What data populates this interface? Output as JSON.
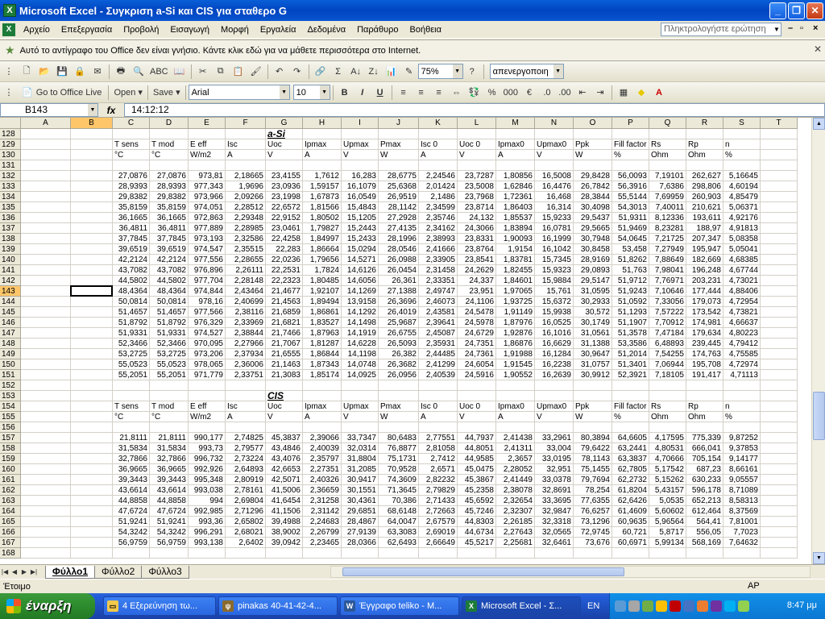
{
  "window": {
    "title": "Microsoft Excel - Συγκριση a-Si και CIS για σταθερο G"
  },
  "menu": {
    "items": [
      "Αρχείο",
      "Επεξεργασία",
      "Προβολή",
      "Εισαγωγή",
      "Μορφή",
      "Εργαλεία",
      "Δεδομένα",
      "Παράθυρο",
      "Βοήθεια"
    ],
    "ask_placeholder": "Πληκτρολογήστε ερώτηση"
  },
  "infobar": {
    "text": "Αυτό το αντίγραφο του Office δεν είναι γνήσιο. Κάντε κλικ εδώ για να μάθετε περισσότερα στο Internet."
  },
  "toolbar1": {
    "zoom": "75%",
    "style_combo": "απενεργοποιη"
  },
  "toolbar2": {
    "office_live": "Go to Office Live",
    "open": "Open",
    "save": "Save",
    "font": "Arial",
    "size": "10"
  },
  "formula": {
    "namebox": "B143",
    "fx": "fx",
    "content": "14:12:12"
  },
  "columns": [
    "A",
    "B",
    "C",
    "D",
    "E",
    "F",
    "G",
    "H",
    "I",
    "J",
    "K",
    "L",
    "M",
    "N",
    "O",
    "P",
    "Q",
    "R",
    "S",
    "T"
  ],
  "selected_col": "B",
  "selected_row": "143",
  "sections": {
    "asi_title": "a-Si",
    "cis_title": "CIS"
  },
  "headers": [
    "T sens",
    "T mod",
    "E eff",
    "Isc",
    "Uoc",
    "Ipmax",
    "Upmax",
    "Pmax",
    "Isc 0",
    "Uoc 0",
    "Ipmax0",
    "Upmax0",
    "Ppk",
    "Fill factor",
    "Rs",
    "Rp",
    "n"
  ],
  "units": [
    "°C",
    "°C",
    "W/m2",
    "A",
    "V",
    "A",
    "V",
    "W",
    "A",
    "V",
    "A",
    "V",
    "W",
    "%",
    "Ohm",
    "Ohm",
    "%"
  ],
  "rows": [
    {
      "n": "128",
      "type": "title",
      "title": "a-Si"
    },
    {
      "n": "129",
      "type": "header"
    },
    {
      "n": "130",
      "type": "units"
    },
    {
      "n": "131",
      "type": "empty"
    },
    {
      "n": "132",
      "type": "data",
      "v": [
        "27,0876",
        "27,0876",
        "973,81",
        "2,18665",
        "23,4155",
        "1,7612",
        "16,283",
        "28,6775",
        "2,24546",
        "23,7287",
        "1,80856",
        "16,5008",
        "29,8428",
        "56,0093",
        "7,19101",
        "262,627",
        "5,16645"
      ]
    },
    {
      "n": "133",
      "type": "data",
      "v": [
        "28,9393",
        "28,9393",
        "977,343",
        "1,9696",
        "23,0936",
        "1,59157",
        "16,1079",
        "25,6368",
        "2,01424",
        "23,5008",
        "1,62846",
        "16,4476",
        "26,7842",
        "56,3916",
        "7,6386",
        "298,806",
        "4,60194"
      ]
    },
    {
      "n": "134",
      "type": "data",
      "v": [
        "29,8382",
        "29,8382",
        "973,966",
        "2,09266",
        "23,1998",
        "1,67873",
        "16,0549",
        "26,9519",
        "2,1486",
        "23,7968",
        "1,72361",
        "16,468",
        "28,3844",
        "55,5144",
        "7,69959",
        "260,903",
        "4,85479"
      ]
    },
    {
      "n": "135",
      "type": "data",
      "v": [
        "35,8159",
        "35,8159",
        "974,051",
        "2,28512",
        "22,6572",
        "1,81566",
        "15,4843",
        "28,1142",
        "2,34599",
        "23,8714",
        "1,86403",
        "16,314",
        "30,4098",
        "54,3013",
        "7,40011",
        "210,621",
        "5,06371"
      ]
    },
    {
      "n": "136",
      "type": "data",
      "v": [
        "36,1665",
        "36,1665",
        "972,863",
        "2,29348",
        "22,9152",
        "1,80502",
        "15,1205",
        "27,2928",
        "2,35746",
        "24,132",
        "1,85537",
        "15,9233",
        "29,5437",
        "51,9311",
        "8,12336",
        "193,611",
        "4,92176"
      ]
    },
    {
      "n": "137",
      "type": "data",
      "v": [
        "36,4811",
        "36,4811",
        "977,889",
        "2,28985",
        "23,0461",
        "1,79827",
        "15,2443",
        "27,4135",
        "2,34162",
        "24,3066",
        "1,83894",
        "16,0781",
        "29,5665",
        "51,9469",
        "8,23281",
        "188,97",
        "4,91813"
      ]
    },
    {
      "n": "138",
      "type": "data",
      "v": [
        "37,7845",
        "37,7845",
        "973,193",
        "2,32586",
        "22,4258",
        "1,84997",
        "15,2433",
        "28,1996",
        "2,38993",
        "23,8331",
        "1,90093",
        "16,1999",
        "30,7948",
        "54,0645",
        "7,21725",
        "207,347",
        "5,08358"
      ]
    },
    {
      "n": "139",
      "type": "data",
      "v": [
        "39,6519",
        "39,6519",
        "974,547",
        "2,35515",
        "22,283",
        "1,86664",
        "15,0294",
        "28,0546",
        "2,41666",
        "23,8764",
        "1,9154",
        "16,1042",
        "30,8458",
        "53,458",
        "7,27949",
        "195,947",
        "5,05041"
      ]
    },
    {
      "n": "140",
      "type": "data",
      "v": [
        "42,2124",
        "42,2124",
        "977,556",
        "2,28655",
        "22,0236",
        "1,79656",
        "14,5271",
        "26,0988",
        "2,33905",
        "23,8541",
        "1,83781",
        "15,7345",
        "28,9169",
        "51,8262",
        "7,88649",
        "182,669",
        "4,68385"
      ]
    },
    {
      "n": "141",
      "type": "data",
      "v": [
        "43,7082",
        "43,7082",
        "976,896",
        "2,26111",
        "22,2531",
        "1,7824",
        "14,6126",
        "26,0454",
        "2,31458",
        "24,2629",
        "1,82455",
        "15,9323",
        "29,0893",
        "51,763",
        "7,98041",
        "196,248",
        "4,67744"
      ]
    },
    {
      "n": "142",
      "type": "data",
      "v": [
        "44,5802",
        "44,5802",
        "977,704",
        "2,28148",
        "22,2323",
        "1,80485",
        "14,6056",
        "26,361",
        "2,33351",
        "24,337",
        "1,84601",
        "15,9884",
        "29,5147",
        "51,9712",
        "7,76971",
        "203,231",
        "4,73021"
      ]
    },
    {
      "n": "143",
      "type": "data",
      "v": [
        "48,4364",
        "48,4364",
        "974,844",
        "2,43464",
        "21,4677",
        "1,92107",
        "14,1269",
        "27,1388",
        "2,49747",
        "23,951",
        "1,97065",
        "15,761",
        "31,0595",
        "51,9243",
        "7,10646",
        "177,444",
        "4,88406"
      ]
    },
    {
      "n": "144",
      "type": "data",
      "v": [
        "50,0814",
        "50,0814",
        "978,16",
        "2,40699",
        "21,4563",
        "1,89494",
        "13,9158",
        "26,3696",
        "2,46073",
        "24,1106",
        "1,93725",
        "15,6372",
        "30,2933",
        "51,0592",
        "7,33056",
        "179,073",
        "4,72954"
      ]
    },
    {
      "n": "145",
      "type": "data",
      "v": [
        "51,4657",
        "51,4657",
        "977,566",
        "2,38116",
        "21,6859",
        "1,86861",
        "14,1292",
        "26,4019",
        "2,43581",
        "24,5478",
        "1,91149",
        "15,9938",
        "30,572",
        "51,1293",
        "7,57222",
        "173,542",
        "4,73821"
      ]
    },
    {
      "n": "146",
      "type": "data",
      "v": [
        "51,8792",
        "51,8792",
        "976,329",
        "2,33969",
        "21,6821",
        "1,83527",
        "14,1498",
        "25,9687",
        "2,39641",
        "24,5978",
        "1,87976",
        "16,0525",
        "30,1749",
        "51,1907",
        "7,70912",
        "174,981",
        "4,66637"
      ]
    },
    {
      "n": "147",
      "type": "data",
      "v": [
        "51,9331",
        "51,9331",
        "974,527",
        "2,38844",
        "21,7466",
        "1,87963",
        "14,1919",
        "26,6755",
        "2,45087",
        "24,6729",
        "1,92876",
        "16,1016",
        "31,0561",
        "51,3578",
        "7,47184",
        "179,634",
        "4,80223"
      ]
    },
    {
      "n": "148",
      "type": "data",
      "v": [
        "52,3466",
        "52,3466",
        "970,095",
        "2,27966",
        "21,7067",
        "1,81287",
        "14,6228",
        "26,5093",
        "2,35931",
        "24,7351",
        "1,86876",
        "16,6629",
        "31,1388",
        "53,3586",
        "6,48893",
        "239,445",
        "4,79412"
      ]
    },
    {
      "n": "149",
      "type": "data",
      "v": [
        "53,2725",
        "53,2725",
        "973,206",
        "2,37934",
        "21,6555",
        "1,86844",
        "14,1198",
        "26,382",
        "2,44485",
        "24,7361",
        "1,91988",
        "16,1284",
        "30,9647",
        "51,2014",
        "7,54255",
        "174,763",
        "4,75585"
      ]
    },
    {
      "n": "150",
      "type": "data",
      "v": [
        "55,0523",
        "55,0523",
        "978,065",
        "2,36006",
        "21,1463",
        "1,87343",
        "14,0748",
        "26,3682",
        "2,41299",
        "24,6054",
        "1,91545",
        "16,2238",
        "31,0757",
        "51,3401",
        "7,06944",
        "195,708",
        "4,72974"
      ]
    },
    {
      "n": "151",
      "type": "data",
      "v": [
        "55,2051",
        "55,2051",
        "971,779",
        "2,33751",
        "21,3083",
        "1,85174",
        "14,0925",
        "26,0956",
        "2,40539",
        "24,5916",
        "1,90552",
        "16,2639",
        "30,9912",
        "52,3921",
        "7,18105",
        "191,417",
        "4,71113"
      ]
    },
    {
      "n": "152",
      "type": "empty"
    },
    {
      "n": "153",
      "type": "title",
      "title": "CIS"
    },
    {
      "n": "154",
      "type": "header"
    },
    {
      "n": "155",
      "type": "units"
    },
    {
      "n": "156",
      "type": "empty"
    },
    {
      "n": "157",
      "type": "data",
      "v": [
        "21,8111",
        "21,8111",
        "990,177",
        "2,74825",
        "45,3837",
        "2,39066",
        "33,7347",
        "80,6483",
        "2,77551",
        "44,7937",
        "2,41438",
        "33,2961",
        "80,3894",
        "64,6605",
        "4,17595",
        "775,339",
        "9,87252"
      ]
    },
    {
      "n": "158",
      "type": "data",
      "v": [
        "31,5834",
        "31,5834",
        "993,73",
        "2,79577",
        "43,4846",
        "2,40039",
        "32,0314",
        "76,8877",
        "2,81058",
        "44,8051",
        "2,41311",
        "33,004",
        "79,6422",
        "63,2441",
        "4,80531",
        "666,041",
        "9,37853"
      ]
    },
    {
      "n": "159",
      "type": "data",
      "v": [
        "32,7866",
        "32,7866",
        "996,732",
        "2,73224",
        "43,4076",
        "2,35797",
        "31,8804",
        "75,1731",
        "2,7412",
        "44,9585",
        "2,3657",
        "33,0195",
        "78,1143",
        "63,3837",
        "4,70666",
        "705,154",
        "9,14177"
      ]
    },
    {
      "n": "160",
      "type": "data",
      "v": [
        "36,9665",
        "36,9665",
        "992,926",
        "2,64893",
        "42,6653",
        "2,27351",
        "31,2085",
        "70,9528",
        "2,6571",
        "45,0475",
        "2,28052",
        "32,951",
        "75,1455",
        "62,7805",
        "5,17542",
        "687,23",
        "8,66161"
      ]
    },
    {
      "n": "161",
      "type": "data",
      "v": [
        "39,3443",
        "39,3443",
        "995,348",
        "2,80919",
        "42,5071",
        "2,40326",
        "30,9417",
        "74,3609",
        "2,82232",
        "45,3867",
        "2,41449",
        "33,0378",
        "79,7694",
        "62,2732",
        "5,15262",
        "630,233",
        "9,05557"
      ]
    },
    {
      "n": "162",
      "type": "data",
      "v": [
        "43,6614",
        "43,6614",
        "993,038",
        "2,78161",
        "41,5006",
        "2,36659",
        "30,1551",
        "71,3645",
        "2,79829",
        "45,2358",
        "2,38078",
        "32,8691",
        "78,254",
        "61,8204",
        "5,43157",
        "596,178",
        "8,71089"
      ]
    },
    {
      "n": "163",
      "type": "data",
      "v": [
        "44,8858",
        "44,8858",
        "994",
        "2,69804",
        "41,6454",
        "2,31258",
        "30,4361",
        "70,386",
        "2,71433",
        "45,6592",
        "2,32654",
        "33,3695",
        "77,6355",
        "62,6426",
        "5,0535",
        "652,213",
        "8,58313"
      ]
    },
    {
      "n": "164",
      "type": "data",
      "v": [
        "47,6724",
        "47,6724",
        "992,985",
        "2,71296",
        "41,1506",
        "2,31142",
        "29,6851",
        "68,6148",
        "2,72663",
        "45,7246",
        "2,32307",
        "32,9847",
        "76,6257",
        "61,4609",
        "5,60602",
        "612,464",
        "8,37569"
      ]
    },
    {
      "n": "165",
      "type": "data",
      "v": [
        "51,9241",
        "51,9241",
        "993,36",
        "2,65802",
        "39,4988",
        "2,24683",
        "28,4867",
        "64,0047",
        "2,67579",
        "44,8303",
        "2,26185",
        "32,3318",
        "73,1296",
        "60,9635",
        "5,96564",
        "564,41",
        "7,81001"
      ]
    },
    {
      "n": "166",
      "type": "data",
      "v": [
        "54,3242",
        "54,3242",
        "996,291",
        "2,68021",
        "38,9002",
        "2,26799",
        "27,9139",
        "63,3083",
        "2,69019",
        "44,6734",
        "2,27643",
        "32,0565",
        "72,9745",
        "60,721",
        "5,8717",
        "556,05",
        "7,7023"
      ]
    },
    {
      "n": "167",
      "type": "data",
      "v": [
        "56,9759",
        "56,9759",
        "993,138",
        "2,6402",
        "39,0942",
        "2,23465",
        "28,0366",
        "62,6493",
        "2,66649",
        "45,5217",
        "2,25681",
        "32,6461",
        "73,676",
        "60,6971",
        "5,99134",
        "568,169",
        "7,64632"
      ]
    },
    {
      "n": "168",
      "type": "empty"
    }
  ],
  "sheets": [
    "Φύλλο1",
    "Φύλλο2",
    "Φύλλο3"
  ],
  "status": {
    "ready": "Έτοιμο",
    "ap": "AP"
  },
  "taskbar": {
    "start": "έναρξη",
    "tasks": [
      "4 Εξερεύνηση τω...",
      "pinakas 40-41-42-4...",
      "Έγγραφο teliko - M...",
      "Microsoft Excel - Σ..."
    ],
    "lang": "EN",
    "clock": "8:47 μμ"
  }
}
